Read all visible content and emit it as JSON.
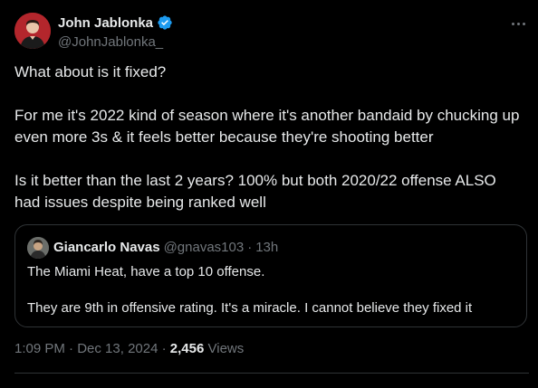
{
  "author": {
    "name": "John Jablonka",
    "handle": "@JohnJablonka_",
    "verified": true
  },
  "tweet": {
    "paragraphs": [
      "What about is it fixed?",
      "For me it's 2022 kind of season where it's another bandaid by chucking up even more 3s & it feels better because they're shooting better",
      "Is it better than the last 2 years? 100% but both 2020/22 offense ALSO had issues despite being ranked well"
    ]
  },
  "quote": {
    "name": "Giancarlo Navas",
    "handle": "@gnavas103",
    "separator": "·",
    "time": "13h",
    "lines": [
      "The Miami Heat, have a top 10 offense.",
      "They are 9th in offensive rating. It's a miracle. I cannot believe they fixed it"
    ]
  },
  "meta": {
    "time": "1:09 PM",
    "date": "Dec 13, 2024",
    "separator": "·",
    "views_count": "2,456",
    "views_label": "Views"
  },
  "colors": {
    "background": "#000000",
    "text": "#e7e9ea",
    "muted": "#71767b",
    "border": "#2f3336",
    "verified": "#1d9bf0"
  }
}
